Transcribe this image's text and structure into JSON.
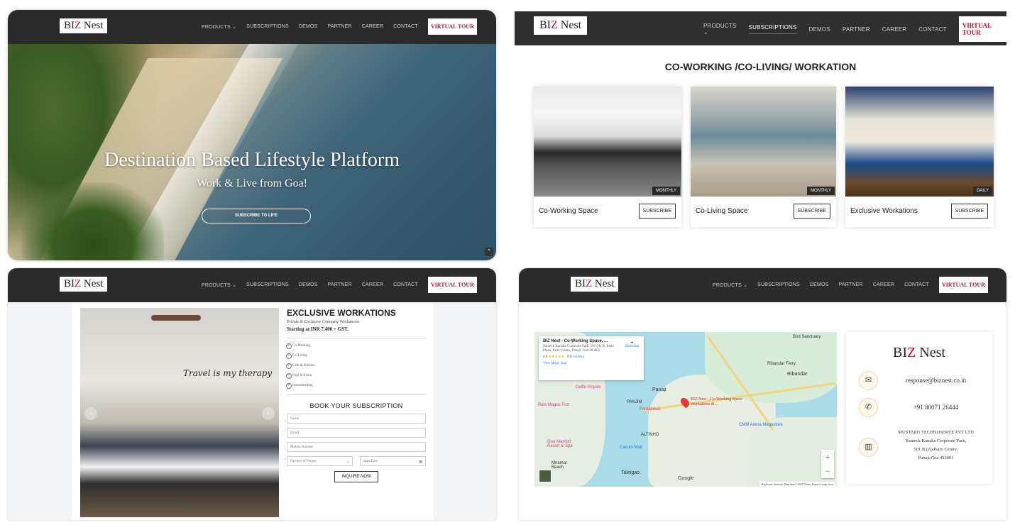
{
  "brand": {
    "left": "BI",
    "z": "Z",
    "right": " Nest"
  },
  "nav": {
    "items": [
      "PRODUCTS ⌄",
      "SUBSCRIPTIONS",
      "DEMOS",
      "PARTNER",
      "CAREER",
      "CONTACT"
    ],
    "tour": "VIRTUAL TOUR"
  },
  "hero": {
    "title": "Destination Based Lifestyle Platform",
    "subtitle": "Work & Live from Goa!",
    "cta": "SUBSCRIBE TO LIFE"
  },
  "subscriptions": {
    "title": "CO-WORKING /CO-LIVING/ WORKATION",
    "cards": [
      {
        "name": "Co-Working Space",
        "badge": "MONTHLY",
        "button": "SUBSCRIBE"
      },
      {
        "name": "Co-Living Space",
        "badge": "MONTHLY",
        "button": "SUBSCRIBE"
      },
      {
        "name": "Exclusive Workations",
        "badge": "DAILY",
        "button": "SUBSCRIBE"
      }
    ]
  },
  "workation": {
    "title": "EXCLUSIVE WORKATIONS",
    "subtitle": "Private & Exclusive Company Workations",
    "price": "Starting at INR 7,400 + GST.",
    "features": [
      "Co-Working",
      "Co-Living",
      "Cafe & Kitchen",
      "Pool & Event",
      "Housekeeping"
    ],
    "booking_title": "BOOK YOUR SUBSCRIPTION",
    "fields": {
      "name": "Name",
      "email": "Email",
      "mobile": "Mobile Number",
      "people": "Number of People",
      "date": "Start Date"
    },
    "submit": "INQUIRE NOW",
    "wall_art": "Travel is my therapy"
  },
  "map": {
    "place_name": "BIZ Nest - Co-Working Space, ...",
    "address": "Sunteck Kanaka Corporate Park, 501 (A) B, Patto Plaza, Patto Centre, Panaji, Goa 403001",
    "rating": "4.9",
    "stars": "★★★★★",
    "reviews": "692 reviews",
    "larger_map": "View larger map",
    "directions": "Directions",
    "pin_label": "BIZ Nest - Co-Working Space Workations &...",
    "labels": {
      "panaji": "Panaji",
      "panjim": "PANJIM",
      "ribandar": "Ribandar",
      "altinho": "ALTINHO",
      "taleigao": "Taleigao",
      "miramar": "Miramar Beach",
      "fontainhas": "Fontainhas",
      "cacula": "Caculo Mall",
      "cmm": "CMM Arena Megastore",
      "reis": "Reis Magos Fort",
      "delfin": "Delfin Royale",
      "ferry": "Ribandar Ferry",
      "bird": "Bird Sanctuary",
      "goa_marriott": "Goa Marriott Resort & Spa"
    },
    "footer": "Keyboard shortcuts   Map data ©2025   Terms   Report a map error",
    "google": "Google"
  },
  "contact": {
    "email": "response@biznest.co.in",
    "phone": "+91 80071 26444",
    "company": "MUSTARO TECHNOSERVE PVT LTD",
    "addr1": "Sunteck Kanaka Corporate Park,",
    "addr2": "501 B (A),Patto Centre,",
    "addr3": "Panaji,Goa 403001"
  }
}
